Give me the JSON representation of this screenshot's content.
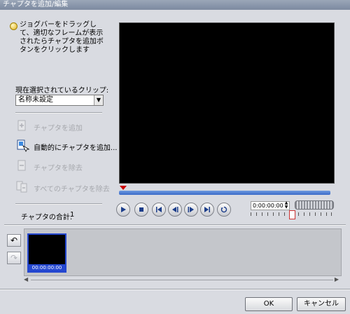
{
  "window": {
    "title": "チャプタを追加/編集"
  },
  "hint": {
    "text": "ジョグバーをドラッグして、適切なフレームが表示されたらチャプタを追加ボタンをクリックします"
  },
  "clip": {
    "label": "現在選択されているクリップ:",
    "selected": "名称未設定"
  },
  "actions": {
    "add_chapter": "チャプタを追加",
    "auto_add": "自動的にチャプタを追加...",
    "remove_chapter": "チャプタを除去",
    "remove_all": "すべてのチャプタを除去"
  },
  "count": {
    "label": "チャプタの合計:",
    "value": "1"
  },
  "player": {
    "timecode": "0:00:00:00"
  },
  "timeline": {
    "thumb_timecode": "00:00:00:00"
  },
  "buttons": {
    "ok": "OK",
    "cancel": "キャンセル"
  }
}
